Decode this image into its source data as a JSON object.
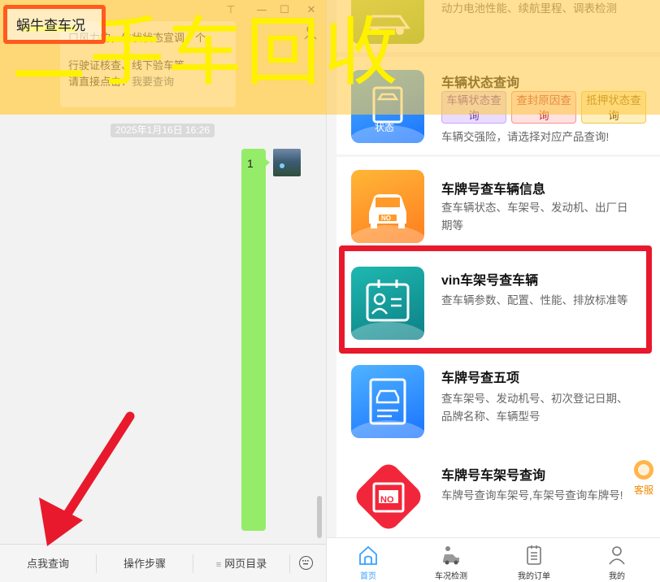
{
  "window": {
    "title": "蜗牛查车况",
    "controls": [
      "⊤",
      "—",
      "☐",
      "✕"
    ]
  },
  "chat": {
    "message_lines": [
      "口风力的，牛状状态宣调、个",
      "行驶证核查、线下验车等。"
    ],
    "message_prefix": "请直接点击：",
    "message_link": "我要查询",
    "timestamp": "2025年1月16日 16:26",
    "bubble_text": "1",
    "bottom_menu": [
      {
        "label": "点我查询",
        "mini": ""
      },
      {
        "label": "操作步骤",
        "mini": ""
      },
      {
        "label": "网页目录",
        "mini": "≡"
      }
    ]
  },
  "services": {
    "partial_top_desc": "动力电池性能、续航里程、调表检测",
    "vehicle_status": {
      "title": "车辆状态查询",
      "tags": [
        "车辆状态查询",
        "查封原因查询",
        "抵押状态查询"
      ],
      "desc": "车辆交强险，请选择对应产品查询!",
      "icon_text": "状态"
    },
    "plate_info": {
      "title": "车牌号查车辆信息",
      "desc": "查车辆状态、车架号、发动机、出厂日期等",
      "icon_text": "NO"
    },
    "vin_query": {
      "title": "vin车架号查车辆",
      "desc": "查车辆参数、配置、性能、排放标准等"
    },
    "plate_five": {
      "title": "车牌号查五项",
      "desc": "查车架号、发动机号、初次登记日期、品牌名称、车辆型号"
    },
    "plate_vin": {
      "title": "车牌号车架号查询",
      "desc": "车牌号查询车架号,车架号查询车牌号!",
      "icon_text": "NO"
    },
    "customer_service": "客服"
  },
  "tabbar": {
    "items": [
      {
        "label": "首页",
        "icon": "home-icon",
        "active": true
      },
      {
        "label": "车况检测",
        "icon": "car-check-icon",
        "active": false
      },
      {
        "label": "我的订单",
        "icon": "order-icon",
        "active": false
      },
      {
        "label": "我的",
        "icon": "user-icon",
        "active": false
      }
    ]
  },
  "overlay": {
    "big_text": "二手车回收",
    "colors": {
      "band": "#ffca46",
      "big_text": "#fff200",
      "red_frame": "#e8192c",
      "title_box": "#ff5a1f",
      "active_tab": "#3aa0ff"
    }
  }
}
